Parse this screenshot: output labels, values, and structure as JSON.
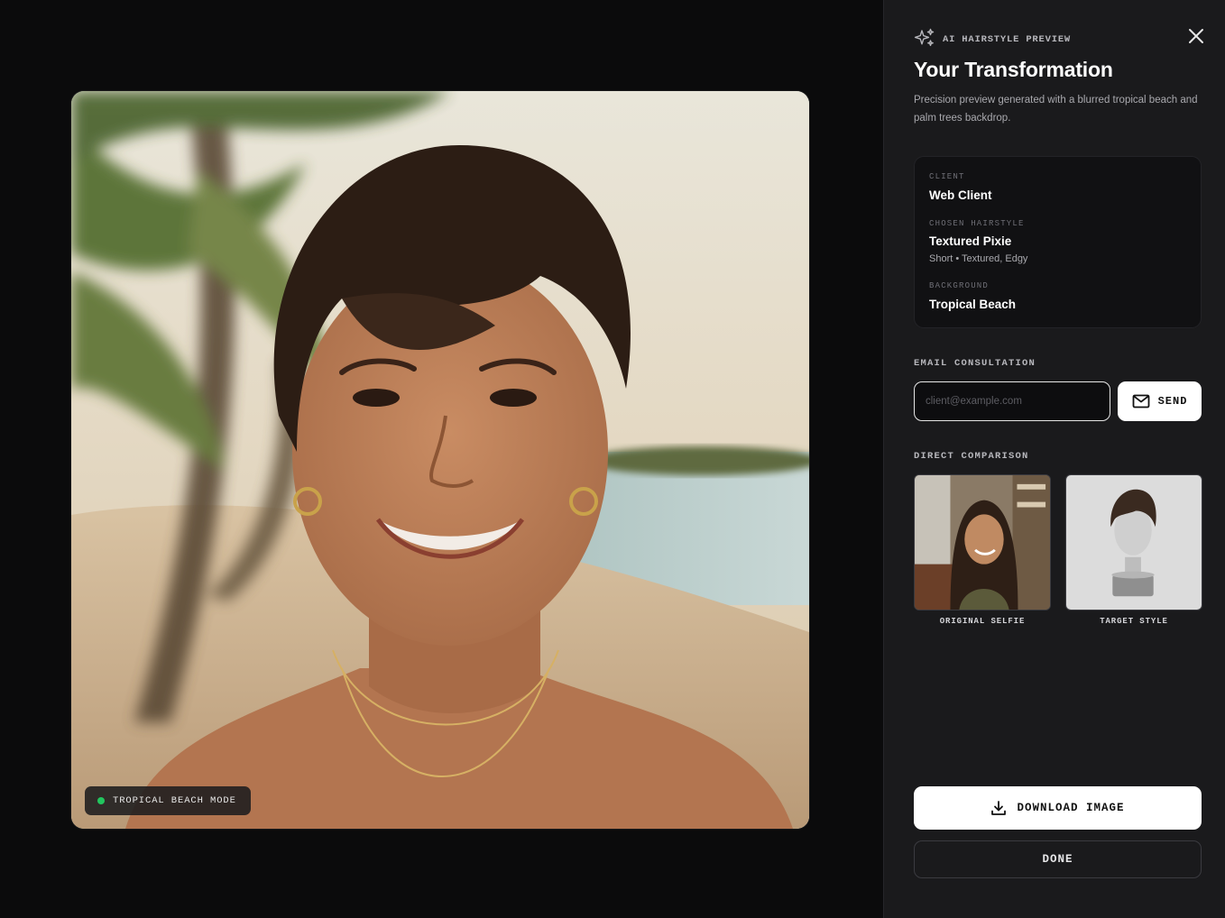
{
  "preview": {
    "image_alt": "Smiling woman with a textured pixie haircut on a tropical beach",
    "mode_badge": "TROPICAL BEACH MODE",
    "mode_color": "#22c55e"
  },
  "panel": {
    "eyebrow": "AI HAIRSTYLE PREVIEW",
    "title": "Your Transformation",
    "description": "Precision preview generated with a blurred tropical beach and palm trees backdrop.",
    "info": {
      "client_label": "CLIENT",
      "client_value": "Web Client",
      "hairstyle_label": "CHOSEN HAIRSTYLE",
      "hairstyle_value": "Textured Pixie",
      "hairstyle_tags": "Short • Textured, Edgy",
      "background_label": "BACKGROUND",
      "background_value": "Tropical Beach"
    },
    "email": {
      "section_label": "EMAIL CONSULTATION",
      "placeholder": "client@example.com",
      "value": "",
      "send_label": "SEND"
    },
    "comparison": {
      "section_label": "DIRECT COMPARISON",
      "original_caption": "ORIGINAL SELFIE",
      "target_caption": "TARGET STYLE"
    },
    "actions": {
      "download_label": "DOWNLOAD IMAGE",
      "done_label": "DONE"
    }
  },
  "colors": {
    "panel_bg": "#1a1a1c",
    "stage_bg": "#0b0b0c",
    "accent_white": "#ffffff"
  },
  "icons": {
    "eyebrow": "sparkles-icon",
    "close": "close-icon",
    "send": "mail-icon",
    "download": "download-icon"
  }
}
